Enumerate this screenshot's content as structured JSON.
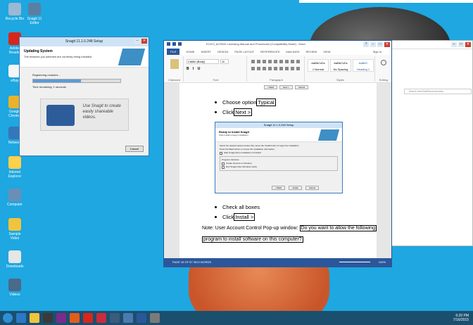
{
  "desktop": {
    "icons": [
      {
        "label": "Recycle Bin",
        "color": "#9bb9d3"
      },
      {
        "label": "Snagit 11 Editor",
        "color": "#5b7fa3"
      },
      {
        "label": "Adobe Reader",
        "color": "#d8261c"
      },
      {
        "label": "eBay",
        "color": "#f5f5f5"
      },
      {
        "label": "Google Chrome",
        "color": "#e8b22a"
      },
      {
        "label": "Network",
        "color": "#3577b8"
      },
      {
        "label": "Internet Explorer",
        "color": "#ffd04a"
      },
      {
        "label": "Computer",
        "color": "#6a8fb7"
      },
      {
        "label": "Sample Video",
        "color": "#f0c43d"
      },
      {
        "label": "Downloads",
        "color": "#e6e6e6"
      },
      {
        "label": "Videos",
        "color": "#4a6a8a"
      }
    ]
  },
  "snagit_setup": {
    "title": "Snagit 11.1.0.248 Setup",
    "header": "Updating System",
    "subheader": "The features you selected are currently being installed.",
    "status": "Registering modules...",
    "progress": 0.55,
    "time_remaining": "Time remaining: 1 seconds",
    "promo_text": "Use Snagit to create easily shareable videos.",
    "cancel": "Cancel"
  },
  "word": {
    "title": "ECDO_ACIRAS Licensing Manual and Procedures [Compatibility Mode] - Word",
    "signin": "Sign in",
    "tabs": [
      "FILE",
      "HOME",
      "INSERT",
      "DESIGN",
      "PAGE LAYOUT",
      "REFERENCES",
      "MAILINGS",
      "REVIEW",
      "VIEW"
    ],
    "font": "Calibri (Body)",
    "size": "11",
    "styles": [
      "AaBbCcDc",
      "AaBbCcDc",
      "AaBbC"
    ],
    "style_names": [
      "1 Normal",
      "No Spacing",
      "Heading 1"
    ],
    "groups": [
      "Clipboard",
      "Font",
      "Paragraph",
      "Styles",
      "Editing"
    ],
    "page_buttons": [
      "< Back",
      "Next >",
      "Cancel"
    ],
    "bullets": [
      {
        "prefix": "Choose option ",
        "boxed": "Typical"
      },
      {
        "prefix": "Click ",
        "boxed": "Next >"
      },
      {
        "prefix": "Check all boxes",
        "boxed": ""
      },
      {
        "prefix": "Click ",
        "boxed": "Install >"
      }
    ],
    "note_prefix": "Note:  User Account Control Pop-up window: ",
    "note_boxed_1": "Do you want to allow the following",
    "note_boxed_2": "program to install software on this computer?",
    "status": "PAGE 16 OF 57    3513 WORDS",
    "zoom": "100%",
    "embedded": {
      "title": "Snagit 11.1.0.248 Setup",
      "header": "Ready to Install Snagit",
      "subheader": "Click Install to begin installation.",
      "line1": "Select the desired options below then press the Install button to begin the installation.",
      "line2": "Press the Back button to review the installation information.",
      "opt1": "Start Snagit when installation is finished",
      "group": "Program shortcuts",
      "opt2": "Create shortcut on Desktop",
      "opt3": "Run Snagit when Windows starts",
      "buttons": [
        "< Back",
        "Install",
        "Cancel"
      ]
    }
  },
  "bg_window": {
    "search": "Search SeeShellServiceAccess"
  },
  "taskbar": {
    "icons": [
      {
        "name": "start",
        "color": "#2d8fd6"
      },
      {
        "name": "ie",
        "color": "#2b78c4"
      },
      {
        "name": "explorer",
        "color": "#f0c43d"
      },
      {
        "name": "media",
        "color": "#3a3a3a"
      },
      {
        "name": "onenote",
        "color": "#7b2b8b"
      },
      {
        "name": "firefox",
        "color": "#e35c1c"
      },
      {
        "name": "acrobat",
        "color": "#d8261c"
      },
      {
        "name": "app",
        "color": "#cc2c3b"
      },
      {
        "name": "settings",
        "color": "#3b5b7b"
      },
      {
        "name": "snagit",
        "color": "#4a7ab0"
      },
      {
        "name": "word",
        "color": "#2b579a"
      },
      {
        "name": "snagit-setup",
        "color": "#7a7a7a"
      }
    ],
    "time": "6:20 PM",
    "date": "7/16/2015"
  }
}
